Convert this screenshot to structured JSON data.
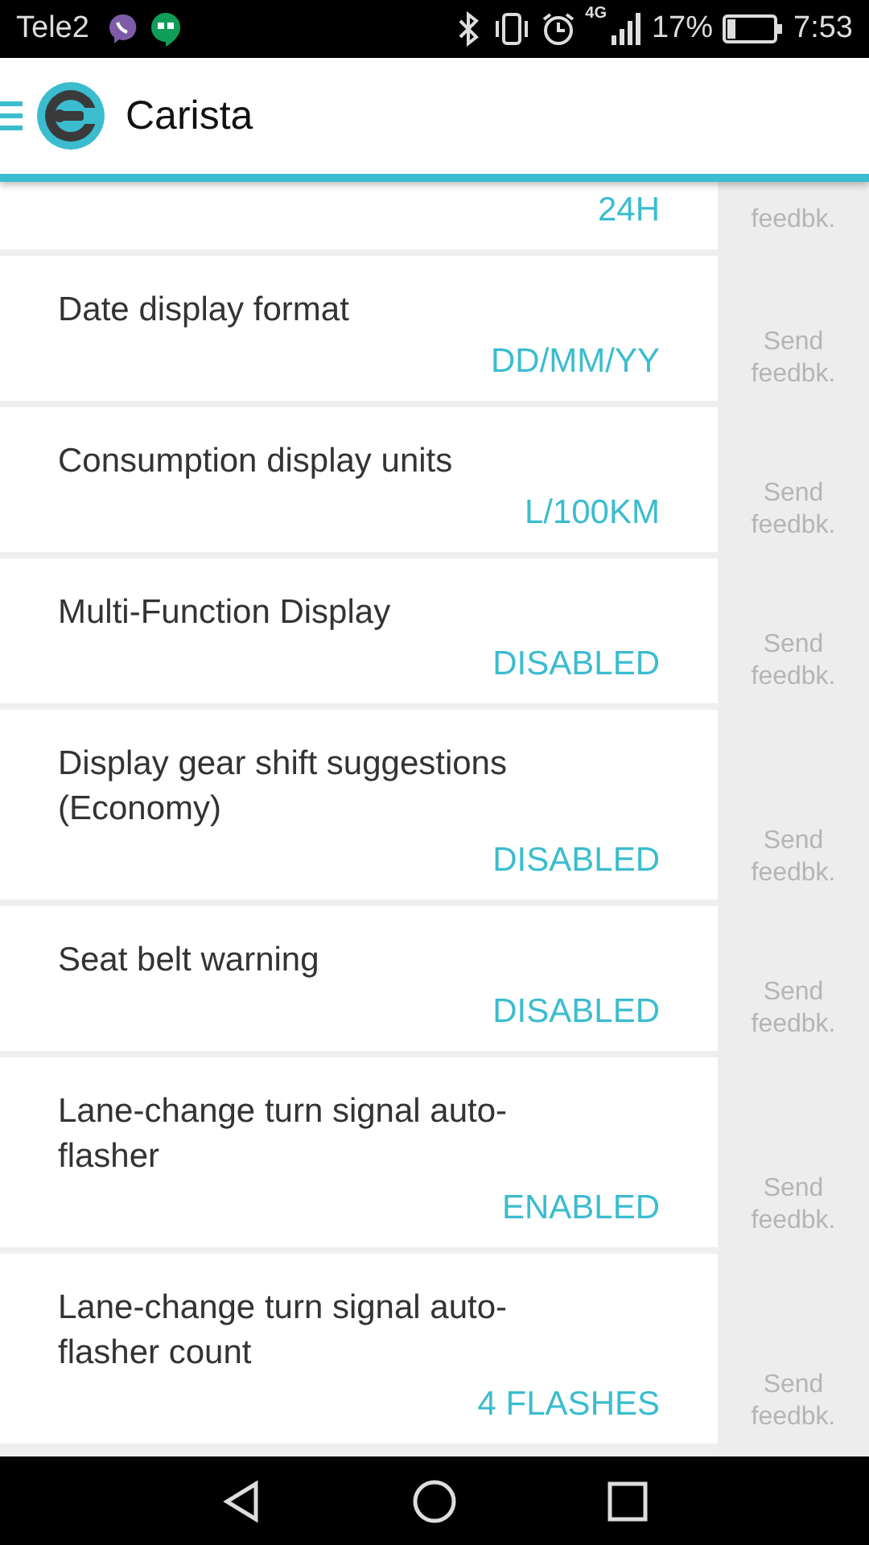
{
  "status_bar": {
    "carrier": "Tele2",
    "network": "4G",
    "battery": "17%",
    "time": "7:53"
  },
  "app_bar": {
    "title": "Carista"
  },
  "settings": [
    {
      "value": "24H",
      "feedback": "feedbk."
    },
    {
      "title": "Date display format",
      "value": "DD/MM/YY",
      "feedback": "Send feedbk."
    },
    {
      "title": "Consumption display units",
      "value": "L/100KM",
      "feedback": "Send feedbk."
    },
    {
      "title": "Multi-Function Display",
      "value": "DISABLED",
      "feedback": "Send feedbk."
    },
    {
      "title": "Display gear shift suggestions (Economy)",
      "value": "DISABLED",
      "feedback": "Send feedbk."
    },
    {
      "title": "Seat belt warning",
      "value": "DISABLED",
      "feedback": "Send feedbk."
    },
    {
      "title": "Lane-change turn signal auto-flasher",
      "value": "ENABLED",
      "feedback": "Send feedbk."
    },
    {
      "title": "Lane-change turn signal auto-flasher count",
      "value": "4 FLASHES",
      "feedback": "Send feedbk."
    }
  ]
}
